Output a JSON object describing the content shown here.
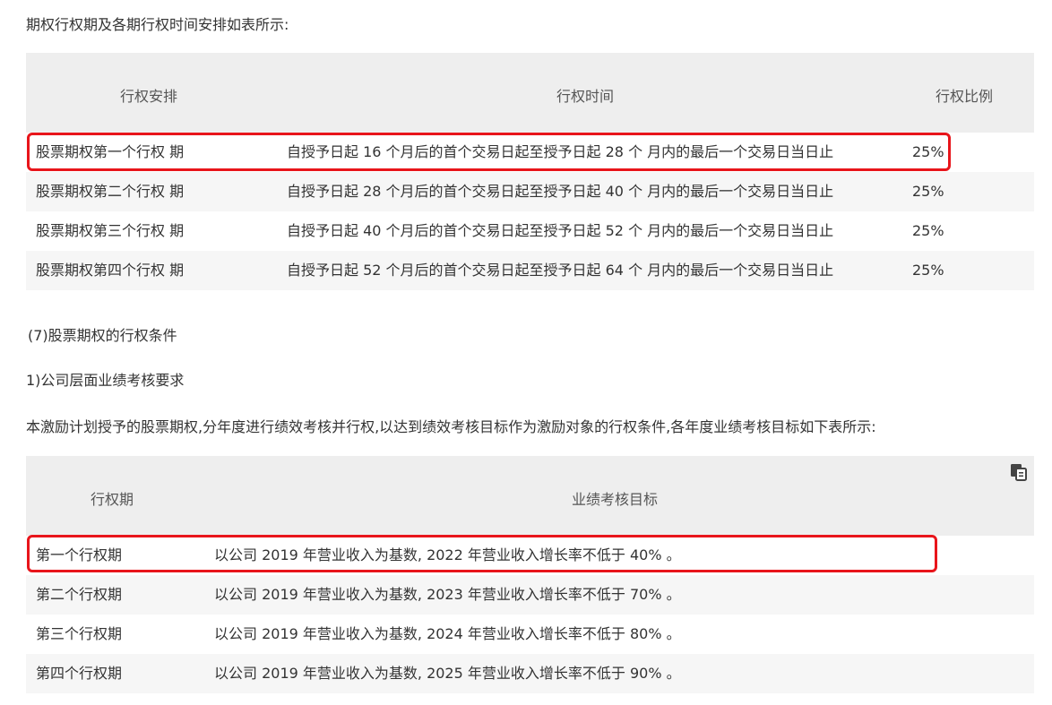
{
  "intro1": "期权行权期及各期行权时间安排如表所示:",
  "table1": {
    "headers": [
      "行权安排",
      "行权时间",
      "行权比例"
    ],
    "rows": [
      [
        "股票期权第一个行权 期",
        "自授予日起 16 个月后的首个交易日起至授予日起 28 个 月内的最后一个交易日当日止",
        "25%"
      ],
      [
        "股票期权第二个行权 期",
        "自授予日起 28 个月后的首个交易日起至授予日起 40 个 月内的最后一个交易日当日止",
        "25%"
      ],
      [
        "股票期权第三个行权 期",
        "自授予日起 40 个月后的首个交易日起至授予日起 52 个 月内的最后一个交易日当日止",
        "25%"
      ],
      [
        "股票期权第四个行权 期",
        "自授予日起 52 个月后的首个交易日起至授予日起 64 个 月内的最后一个交易日当日止",
        "25%"
      ]
    ]
  },
  "section7": "(7)股票期权的行权条件",
  "sub1": "1)公司层面业绩考核要求",
  "intro2": "本激励计划授予的股票期权,分年度进行绩效考核并行权,以达到绩效考核目标作为激励对象的行权条件,各年度业绩考核目标如下表所示:",
  "table2": {
    "headers": [
      "行权期",
      "业绩考核目标"
    ],
    "rows": [
      [
        "第一个行权期",
        "以公司 2019 年营业收入为基数, 2022 年营业收入增长率不低于 40% 。"
      ],
      [
        "第二个行权期",
        "以公司 2019 年营业收入为基数, 2023 年营业收入增长率不低于 70% 。"
      ],
      [
        "第三个行权期",
        "以公司 2019 年营业收入为基数, 2024 年营业收入增长率不低于 80% 。"
      ],
      [
        "第四个行权期",
        "以公司 2019 年营业收入为基数, 2025 年营业收入增长率不低于 90% 。"
      ]
    ]
  },
  "colors": {
    "highlight": "#e8151b",
    "header_bg": "#eeeeee",
    "alt_row_bg": "#f6f6f6"
  },
  "icons": {
    "copy": "copy-icon"
  }
}
